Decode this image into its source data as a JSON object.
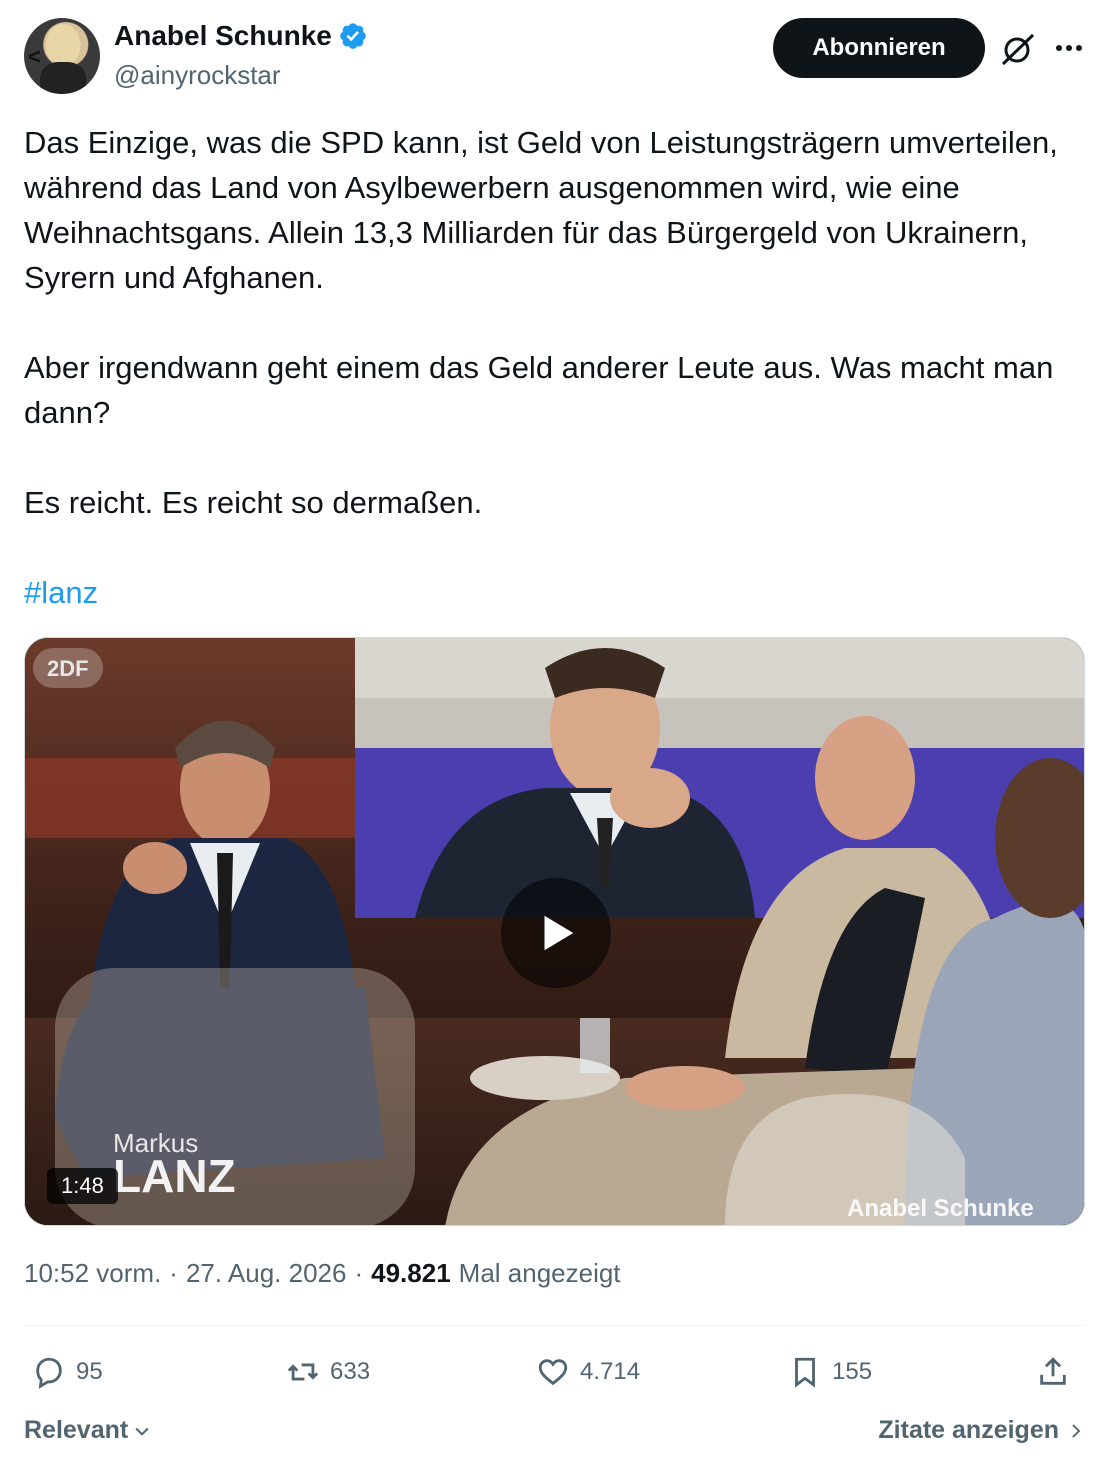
{
  "author": {
    "name": "Anabel Schunke",
    "handle": "@ainyrockstar",
    "verified": true,
    "avatar_icon": "avatar-photo"
  },
  "header": {
    "follow_label": "Abonnieren",
    "grok_icon": "grok-icon",
    "more_icon": "more-icon"
  },
  "tweet": {
    "paragraphs": [
      "Das Einzige, was die SPD kann, ist Geld von Leistungsträgern umverteilen, während das Land von Asylbewerbern ausgenommen wird, wie eine Weihnachtsgans. Allein 13,3 Milliarden für das Bürgergeld von Ukrainern, Syrern und Afghanen.",
      "Aber irgendwann geht einem das Geld anderer Leute aus. Was macht man dann?",
      "Es reicht. Es reicht so dermaßen."
    ],
    "hashtag": "#lanz"
  },
  "media": {
    "type": "video",
    "duration": "1:48",
    "channel_logo": "2DF",
    "show_label_top": "Markus",
    "show_label_bottom": "LANZ",
    "watermark": "Anabel Schunke"
  },
  "meta": {
    "time": "10:52 vorm.",
    "date": "27. Aug. 2026",
    "views_count": "49.821",
    "views_label": "Mal angezeigt"
  },
  "actions": {
    "replies": "95",
    "reposts": "633",
    "likes": "4.714",
    "bookmarks": "155"
  },
  "footer": {
    "sort_label": "Relevant",
    "quotes_label": "Zitate anzeigen"
  },
  "colors": {
    "text": "#0f1419",
    "secondary": "#536471",
    "link": "#1d9bf0",
    "verified": "#1d9bf0",
    "button_bg": "#0f1419"
  }
}
